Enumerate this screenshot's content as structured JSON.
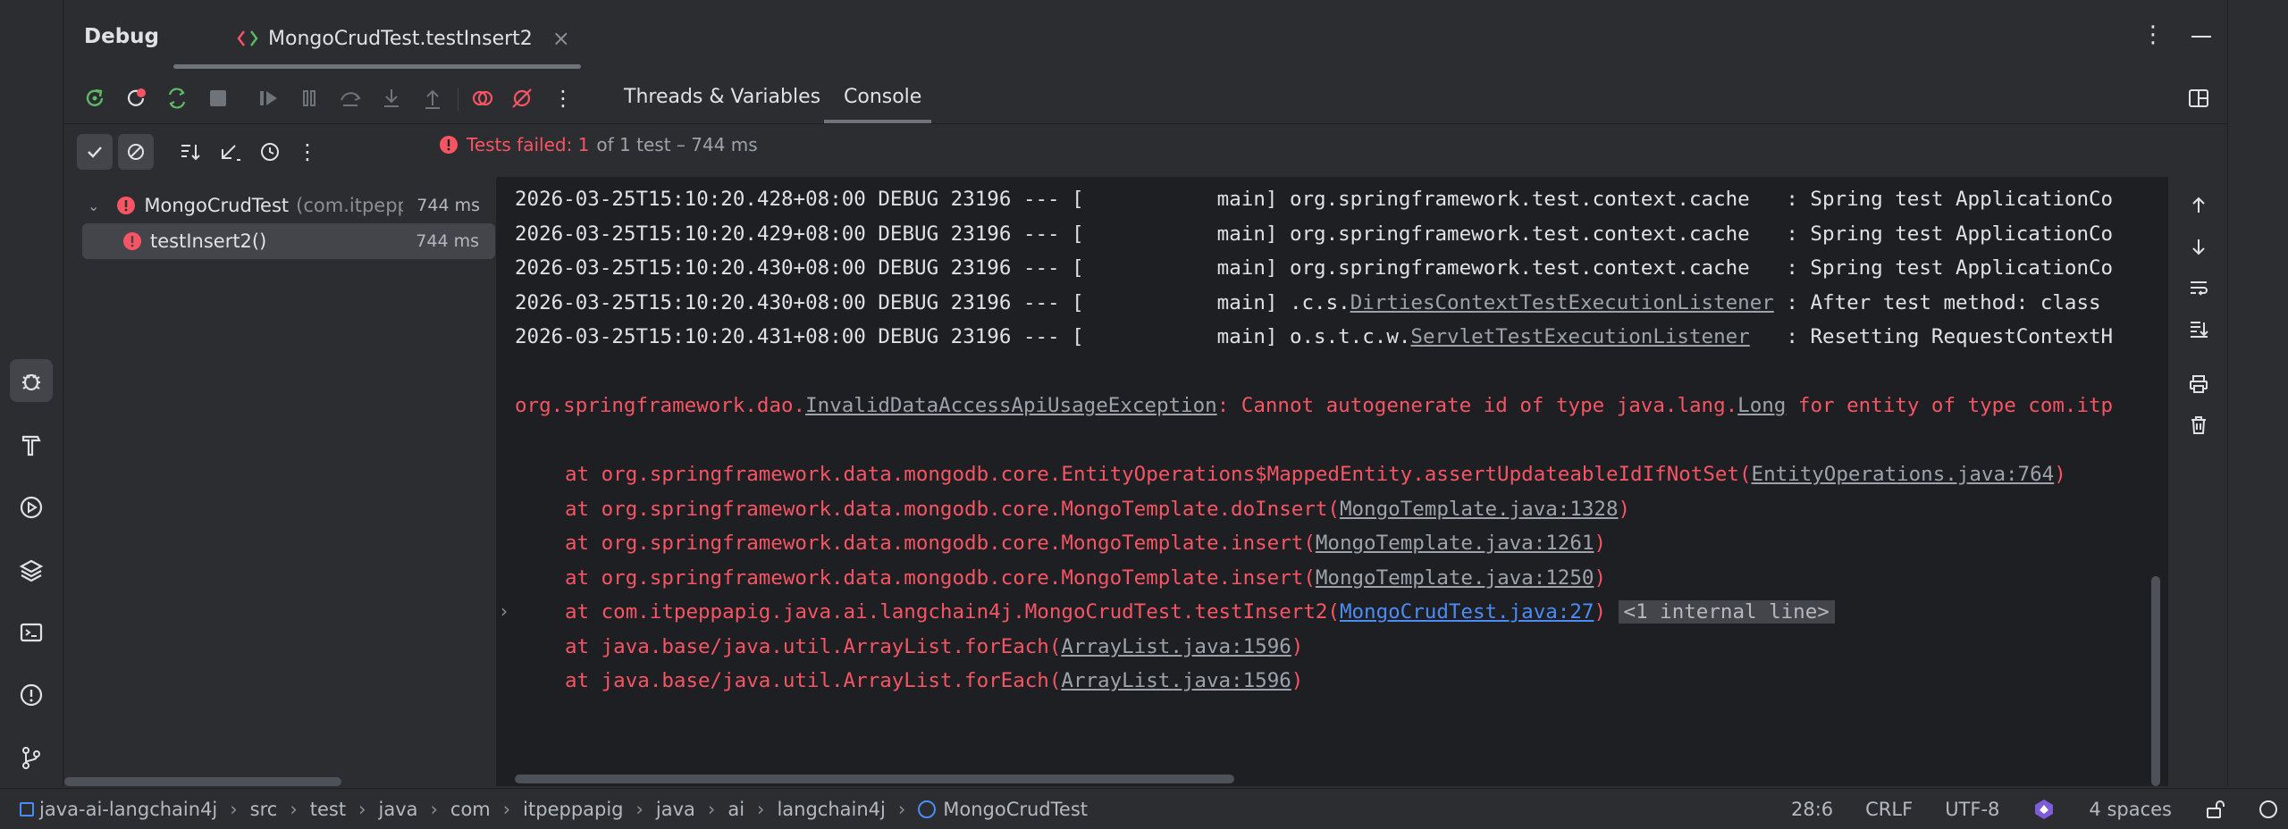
{
  "header": {
    "panel_title": "Debug",
    "session_tab": "MongoCrudTest.testInsert2"
  },
  "toolbar": {
    "tab_threads": "Threads & Variables",
    "tab_console": "Console"
  },
  "test_status": {
    "failed_label": "Tests failed: 1",
    "summary": "of 1 test – 744 ms"
  },
  "tree": {
    "root": {
      "name": "MongoCrudTest",
      "pkg": "(com.itpeppa",
      "time": "744 ms"
    },
    "child": {
      "name": "testInsert2()",
      "time": "744 ms"
    }
  },
  "console": {
    "log_lines": [
      {
        "prefix": "2026-03-25T15:10:20.428+08:00 DEBUG 23196 --- [           main] org.springframework.test.context.cache   : Spring test ApplicationCo"
      },
      {
        "prefix": "2026-03-25T15:10:20.429+08:00 DEBUG 23196 --- [           main] org.springframework.test.context.cache   : Spring test ApplicationCo"
      },
      {
        "prefix": "2026-03-25T15:10:20.430+08:00 DEBUG 23196 --- [           main] org.springframework.test.context.cache   : Spring test ApplicationCo"
      },
      {
        "prefix": "2026-03-25T15:10:20.430+08:00 DEBUG 23196 --- [           main] .c.s.",
        "link": "DirtiesContextTestExecutionListener",
        "suffix": " : After test method: class "
      },
      {
        "prefix": "2026-03-25T15:10:20.431+08:00 DEBUG 23196 --- [           main] o.s.t.c.w.",
        "link": "ServletTestExecutionListener",
        "suffix": "   : Resetting RequestContextH"
      }
    ],
    "exception": {
      "prefix": "org.springframework.dao.",
      "link": "InvalidDataAccessApiUsageException",
      "middle": ": Cannot autogenerate id of type java.lang.",
      "link2": "Long",
      "suffix": " for entity of type com.itp"
    },
    "trace": [
      {
        "text": "at org.springframework.data.mongodb.core.EntityOperations$MappedEntity.assertUpdateableIdIfNotSet(",
        "link": "EntityOperations.java:764",
        "end": ")"
      },
      {
        "text": "at org.springframework.data.mongodb.core.MongoTemplate.doInsert(",
        "link": "MongoTemplate.java:1328",
        "end": ")"
      },
      {
        "text": "at org.springframework.data.mongodb.core.MongoTemplate.insert(",
        "link": "MongoTemplate.java:1261",
        "end": ")"
      },
      {
        "text": "at org.springframework.data.mongodb.core.MongoTemplate.insert(",
        "link": "MongoTemplate.java:1250",
        "end": ")"
      },
      {
        "text": "at com.itpeppapig.java.ai.langchain4j.MongoCrudTest.testInsert2(",
        "link": "MongoCrudTest.java:27",
        "end": ")",
        "internal": "<1 internal line>",
        "blue": true
      },
      {
        "text": "at java.base/java.util.ArrayList.forEach(",
        "link": "ArrayList.java:1596",
        "end": ")"
      },
      {
        "text": "at java.base/java.util.ArrayList.forEach(",
        "link": "ArrayList.java:1596",
        "end": ")"
      }
    ]
  },
  "statusbar": {
    "crumbs": [
      "java-ai-langchain4j",
      "src",
      "test",
      "java",
      "com",
      "itpeppapig",
      "java",
      "ai",
      "langchain4j",
      "MongoCrudTest"
    ],
    "position": "28:6",
    "line_sep": "CRLF",
    "encoding": "UTF-8",
    "indent": "4 spaces"
  },
  "colors": {
    "error": "#f75464",
    "link_blue": "#4c8cf8",
    "console_bg": "#1e1f22",
    "panel_bg": "#2b2d30"
  }
}
